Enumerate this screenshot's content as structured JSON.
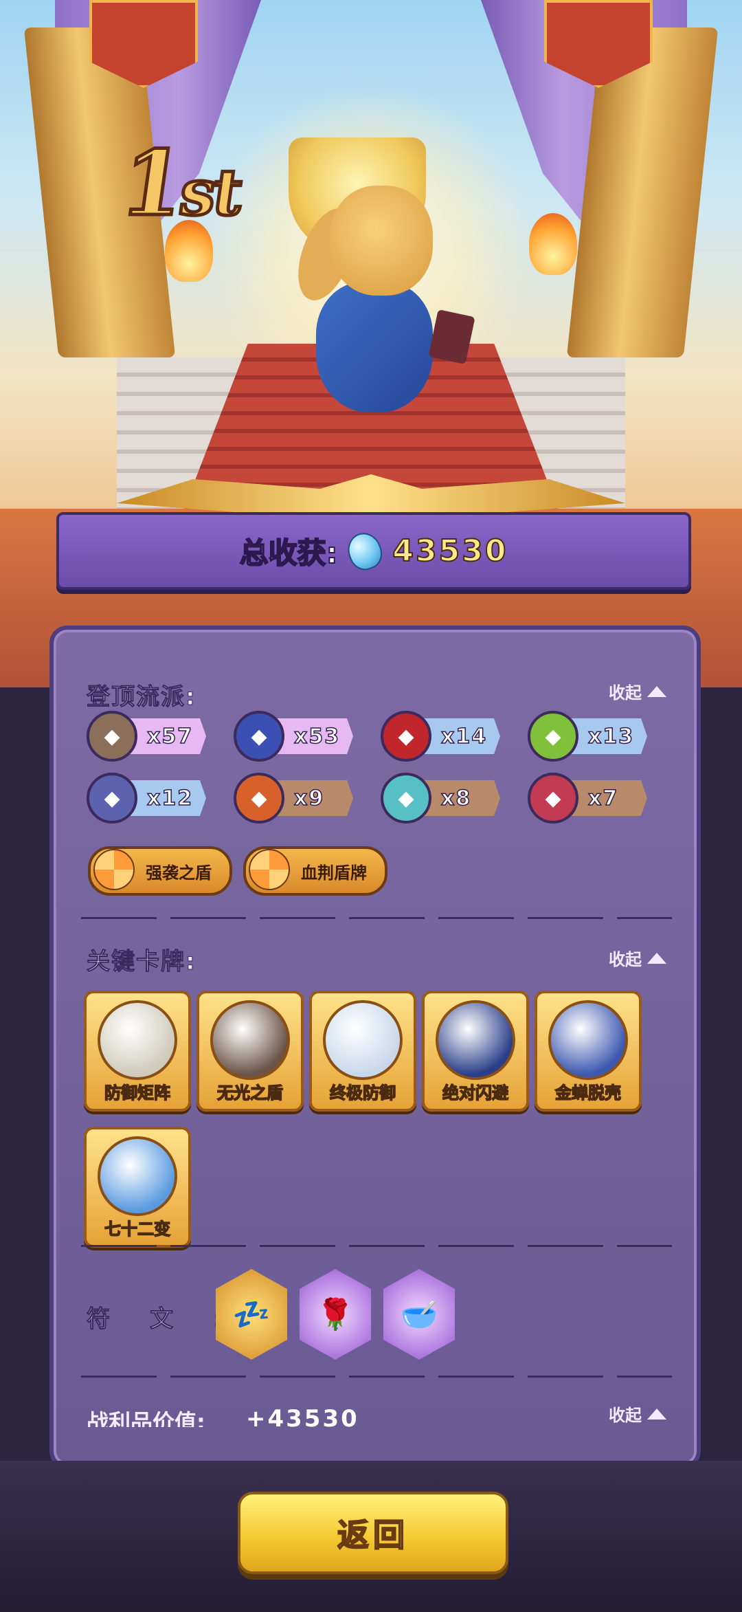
{
  "rank": {
    "num": "1",
    "suffix": "st"
  },
  "total": {
    "label": "总收获:",
    "value": "43530"
  },
  "build": {
    "title": "登顶流派:",
    "collapse_label": "收起",
    "chips": [
      {
        "icon": "shield-icon",
        "count": "x57",
        "color": "#e7b9f2",
        "ic": "#8b6f5a"
      },
      {
        "icon": "boot-icon",
        "count": "x53",
        "color": "#e7b9f2",
        "ic": "#3c4fb2"
      },
      {
        "icon": "flame-burst-icon",
        "count": "x14",
        "color": "#a7c9ef",
        "ic": "#c2262d"
      },
      {
        "icon": "plus-icon",
        "count": "x13",
        "color": "#a7c9ef",
        "ic": "#7fc13a"
      },
      {
        "icon": "sword-icon",
        "count": "x12",
        "color": "#a7c9ef",
        "ic": "#5b62b0"
      },
      {
        "icon": "fire-icon",
        "count": "x9",
        "color": "#b98a6a",
        "ic": "#d8602a"
      },
      {
        "icon": "snowflake-icon",
        "count": "x8",
        "color": "#b98a6a",
        "ic": "#56c0c4"
      },
      {
        "icon": "claw-icon",
        "count": "x7",
        "color": "#b98a6a",
        "ic": "#c23b52"
      }
    ],
    "pills": [
      {
        "icon": "swirl-icon",
        "label": "强袭之盾"
      },
      {
        "icon": "swirl-icon",
        "label": "血荆盾牌"
      }
    ]
  },
  "cards": {
    "title": "关键卡牌:",
    "collapse_label": "收起",
    "items": [
      {
        "name": "防御矩阵",
        "art": "#cfcaba"
      },
      {
        "name": "无光之盾",
        "art": "#6b5346"
      },
      {
        "name": "终极防御",
        "art": "#c8d8ea"
      },
      {
        "name": "绝对闪避",
        "art": "#2a3f8a"
      },
      {
        "name": "金蝉脱壳",
        "art": "#3d58b0"
      },
      {
        "name": "七十二变",
        "art": "#5a9be0"
      }
    ]
  },
  "runes": {
    "label": "符文:",
    "items": [
      {
        "icon": "sleeping-chick-icon",
        "glyph": "💤",
        "style": "gold"
      },
      {
        "icon": "rose-icon",
        "glyph": "🌹",
        "style": "purple"
      },
      {
        "icon": "bowl-icon",
        "glyph": "🥣",
        "style": "purple"
      }
    ]
  },
  "loot": {
    "label": "战利品价值:",
    "value": "+43530",
    "collapse_label": "收起"
  },
  "back_button": "返回"
}
